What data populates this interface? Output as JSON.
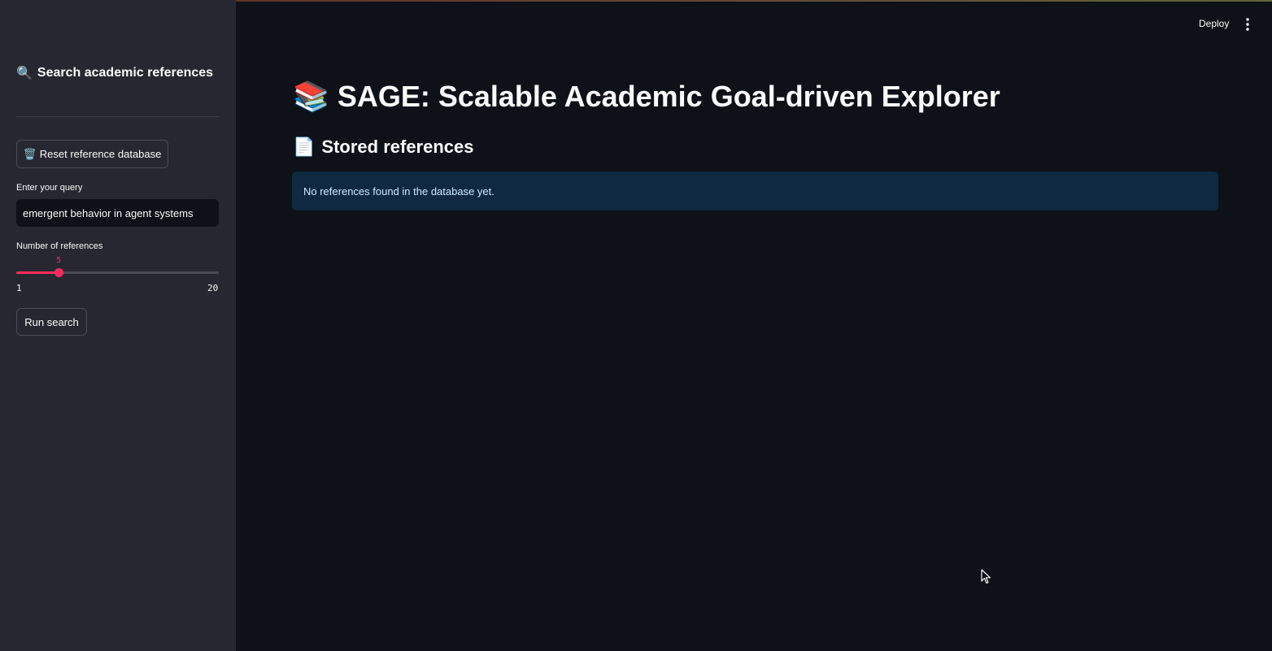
{
  "sidebar": {
    "title_icon": "🔍",
    "title": "Search academic references",
    "reset_icon": "🗑️",
    "reset_label": "Reset reference database",
    "query_label": "Enter your query",
    "query_value": "emergent behavior in agent systems",
    "num_label": "Number of references",
    "slider": {
      "value": "5",
      "min": "1",
      "max": "20",
      "fraction": 0.21
    },
    "run_label": "Run search"
  },
  "header": {
    "deploy_label": "Deploy"
  },
  "main": {
    "title_icon": "📚",
    "title": "SAGE: Scalable Academic Goal-driven Explorer",
    "section_icon": "📄",
    "section_title": "Stored references",
    "info_message": "No references found in the database yet."
  },
  "colors": {
    "accent": "#ff2b5e",
    "background": "#0e1117",
    "sidebar": "#262730",
    "info_bg": "#0f2a40"
  }
}
